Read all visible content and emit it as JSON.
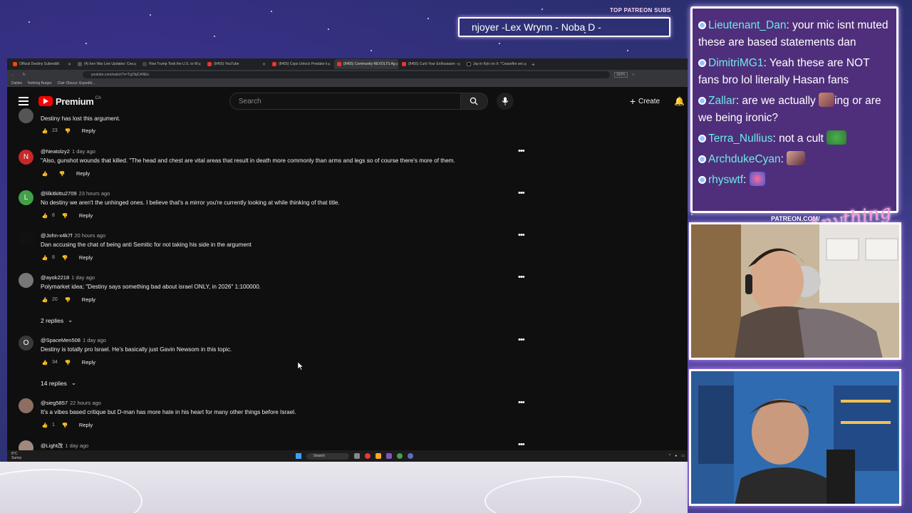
{
  "overlay": {
    "patreon_title": "TOP PATREON SUBS",
    "patreon_names": "njoyer -Lex Wrynn -  Noba D -",
    "cam_label": "PATREON.COM/",
    "cam_script": "Anything Else"
  },
  "chat": {
    "messages": [
      {
        "user": "Lieutenant_Dan",
        "text": "your mic isnt muted these are based statements dan"
      },
      {
        "user": "DimitriMG1",
        "text": "Yeah these are NOT fans bro lol literally Hasan fans"
      },
      {
        "user": "Zallar",
        "text": "are we actually ",
        "text2": "ing or are we being ironic?"
      },
      {
        "user": "Terra_Nullius",
        "text": "not a cult"
      },
      {
        "user": "ArchdukeCyan",
        "text": ""
      },
      {
        "user": "rhyswtf",
        "text": ""
      }
    ]
  },
  "browser": {
    "tabs": [
      "Official Destiny Subreddit",
      "(4) Iron War Live Updates: Cea",
      "How Trump Took the U.S. to W",
      "(8455) YouTube",
      "(8455) Cops Unlock Predator's",
      "(8455) Community REVOLTS Ag",
      "(8455) Curb Your Enthusiasm -",
      "Jay in Kyiv on X: \"Ceasefire sec"
    ],
    "url": "youtube.com/watch?v=TgObjCANEo",
    "zoom": "160%",
    "bookmarks": [
      "Dailies",
      "Nothing Burger",
      "Clair Obscur: Expediti..."
    ]
  },
  "youtube": {
    "logo": "Premium",
    "country": "CA",
    "search_placeholder": "Search",
    "create_label": "Create"
  },
  "comments": [
    {
      "user": "",
      "time": "",
      "text": "Destiny has lost this argument.",
      "likes": "23",
      "avatar": "",
      "avatar_color": "#555"
    },
    {
      "user": "@Neatolzy2",
      "time": "1 day ago",
      "text": "\"Also, gunshot wounds that killed. \"The head and chest are vital areas that result in death more commonly than arms and legs so of course there's more of them.",
      "likes": "",
      "avatar": "N",
      "avatar_color": "#c62828"
    },
    {
      "user": "@lilkitkittu2709",
      "time": "23 hours ago",
      "text": "No destiny we aren't the unhinged ones. I believe that's a mirror you're currently looking at while thinking of that title.",
      "likes": "8",
      "avatar": "L",
      "avatar_color": "#43a047"
    },
    {
      "user": "@John-x4k7f",
      "time": "20 hours ago",
      "text": "Dan accusing the chat of being anti Semitic for not taking his side in the argument",
      "likes": "8",
      "avatar": "",
      "avatar_color": "#111"
    },
    {
      "user": "@ayok2218",
      "time": "1 day ago",
      "text": "Polymarket idea; \"Destiny says something bad about israel ONLY, in 2026\" 1:100000.",
      "likes": "20",
      "avatar": "",
      "avatar_color": "#777"
    },
    {
      "user": "@SpaceMen508",
      "time": "1 day ago",
      "text": "Destiny is totally pro Israel. He's basically just Gavin Newsom in this topic.",
      "likes": "34",
      "avatar": "O",
      "avatar_color": "#3a3a3a"
    },
    {
      "user": "@sieg5857",
      "time": "22 hours ago",
      "text": "It's a vibes based critique but D-man has more hate in his heart for many other things before Israel.",
      "likes": "1",
      "avatar": "",
      "avatar_color": "#8d6e63"
    },
    {
      "user": "@Light改",
      "time": "1 day ago",
      "text": "",
      "likes": "",
      "avatar": "",
      "avatar_color": "#a1887f"
    }
  ],
  "replies": [
    "2 replies",
    "14 replies"
  ],
  "reply_label": "Reply",
  "taskbar": {
    "weather_temp": "8°C",
    "weather_text": "Sunny",
    "search": "Search"
  }
}
